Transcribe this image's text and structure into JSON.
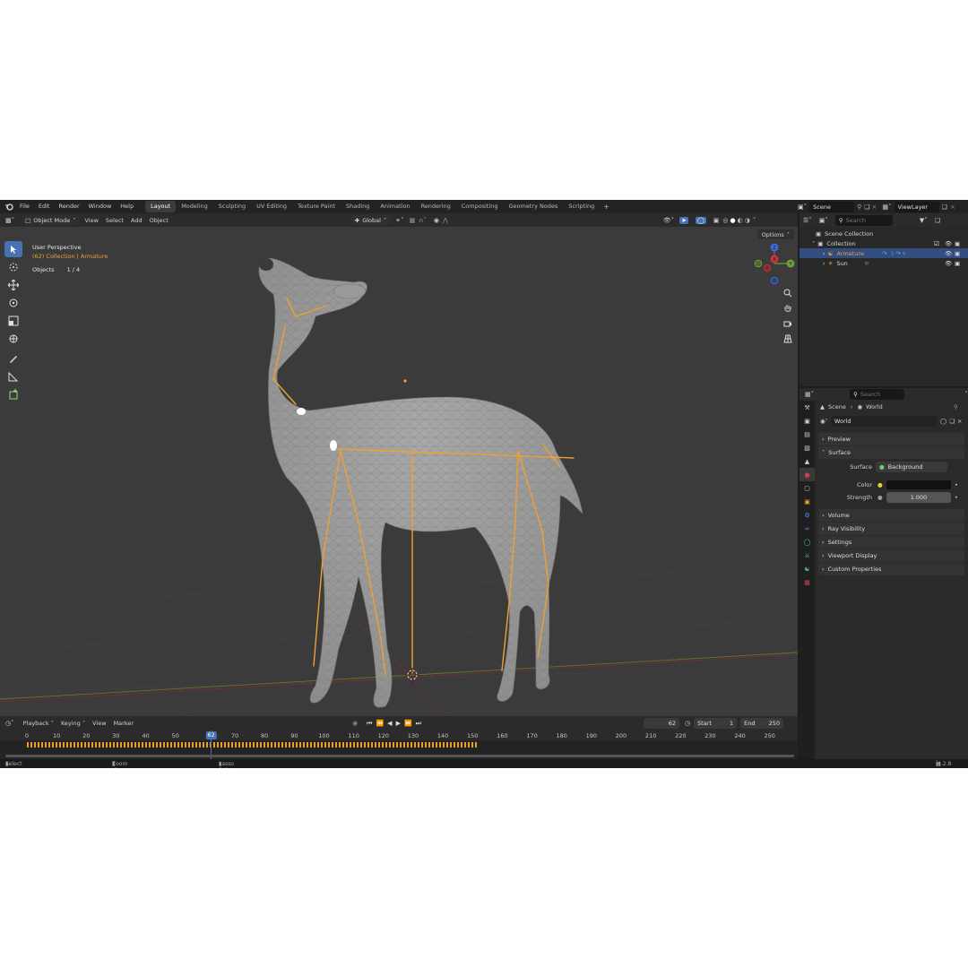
{
  "menu": {
    "items": [
      "File",
      "Edit",
      "Render",
      "Window",
      "Help"
    ]
  },
  "workspaces": [
    "Layout",
    "Modeling",
    "Sculpting",
    "UV Editing",
    "Texture Paint",
    "Shading",
    "Animation",
    "Rendering",
    "Compositing",
    "Geometry Nodes",
    "Scripting"
  ],
  "active_workspace": "Layout",
  "scene": {
    "name": "Scene",
    "view_layer": "ViewLayer"
  },
  "viewport_header": {
    "mode": "Object Mode",
    "menus": [
      "View",
      "Select",
      "Add",
      "Object"
    ],
    "transform": "Global"
  },
  "viewport": {
    "perspective": "User Perspective",
    "collection_path": "(62) Collection | Armature",
    "objects_label": "Objects",
    "objects_value": "1 / 4",
    "options": "Options",
    "gizmo": {
      "x": "X",
      "y": "Y",
      "z": "Z"
    }
  },
  "timeline": {
    "menus": [
      "Playback",
      "Keying",
      "View",
      "Marker"
    ],
    "current_frame": "62",
    "start_label": "Start",
    "start": "1",
    "end_label": "End",
    "end": "250",
    "ticks": [
      "0",
      "10",
      "20",
      "30",
      "40",
      "50",
      "70",
      "80",
      "90",
      "100",
      "110",
      "120",
      "130",
      "140",
      "150",
      "160",
      "170",
      "180",
      "190",
      "200",
      "210",
      "220",
      "230",
      "240",
      "250"
    ]
  },
  "status": {
    "select": "Select",
    "zoom": "Zoom View",
    "lasso": "Lasso Select",
    "version": "4.2.8"
  },
  "outliner": {
    "search_placeholder": "Search",
    "root": "Scene Collection",
    "collection": "Collection",
    "items": [
      {
        "name": "Armature",
        "selected": true
      },
      {
        "name": "Sun",
        "selected": false
      }
    ]
  },
  "properties": {
    "search_placeholder": "Search",
    "breadcrumb": [
      "Scene",
      "World"
    ],
    "world_name": "World",
    "panels_top": [
      "Preview",
      "Surface"
    ],
    "surface_label": "Surface",
    "surface_value": "Background",
    "color_label": "Color",
    "strength_label": "Strength",
    "strength_value": "1.000",
    "panels_bottom": [
      "Volume",
      "Ray Visibility",
      "Settings",
      "Viewport Display",
      "Custom Properties"
    ]
  },
  "colors": {
    "accent": "#4772b3",
    "bone": "#f0a030",
    "selected_row": "#334d80"
  }
}
